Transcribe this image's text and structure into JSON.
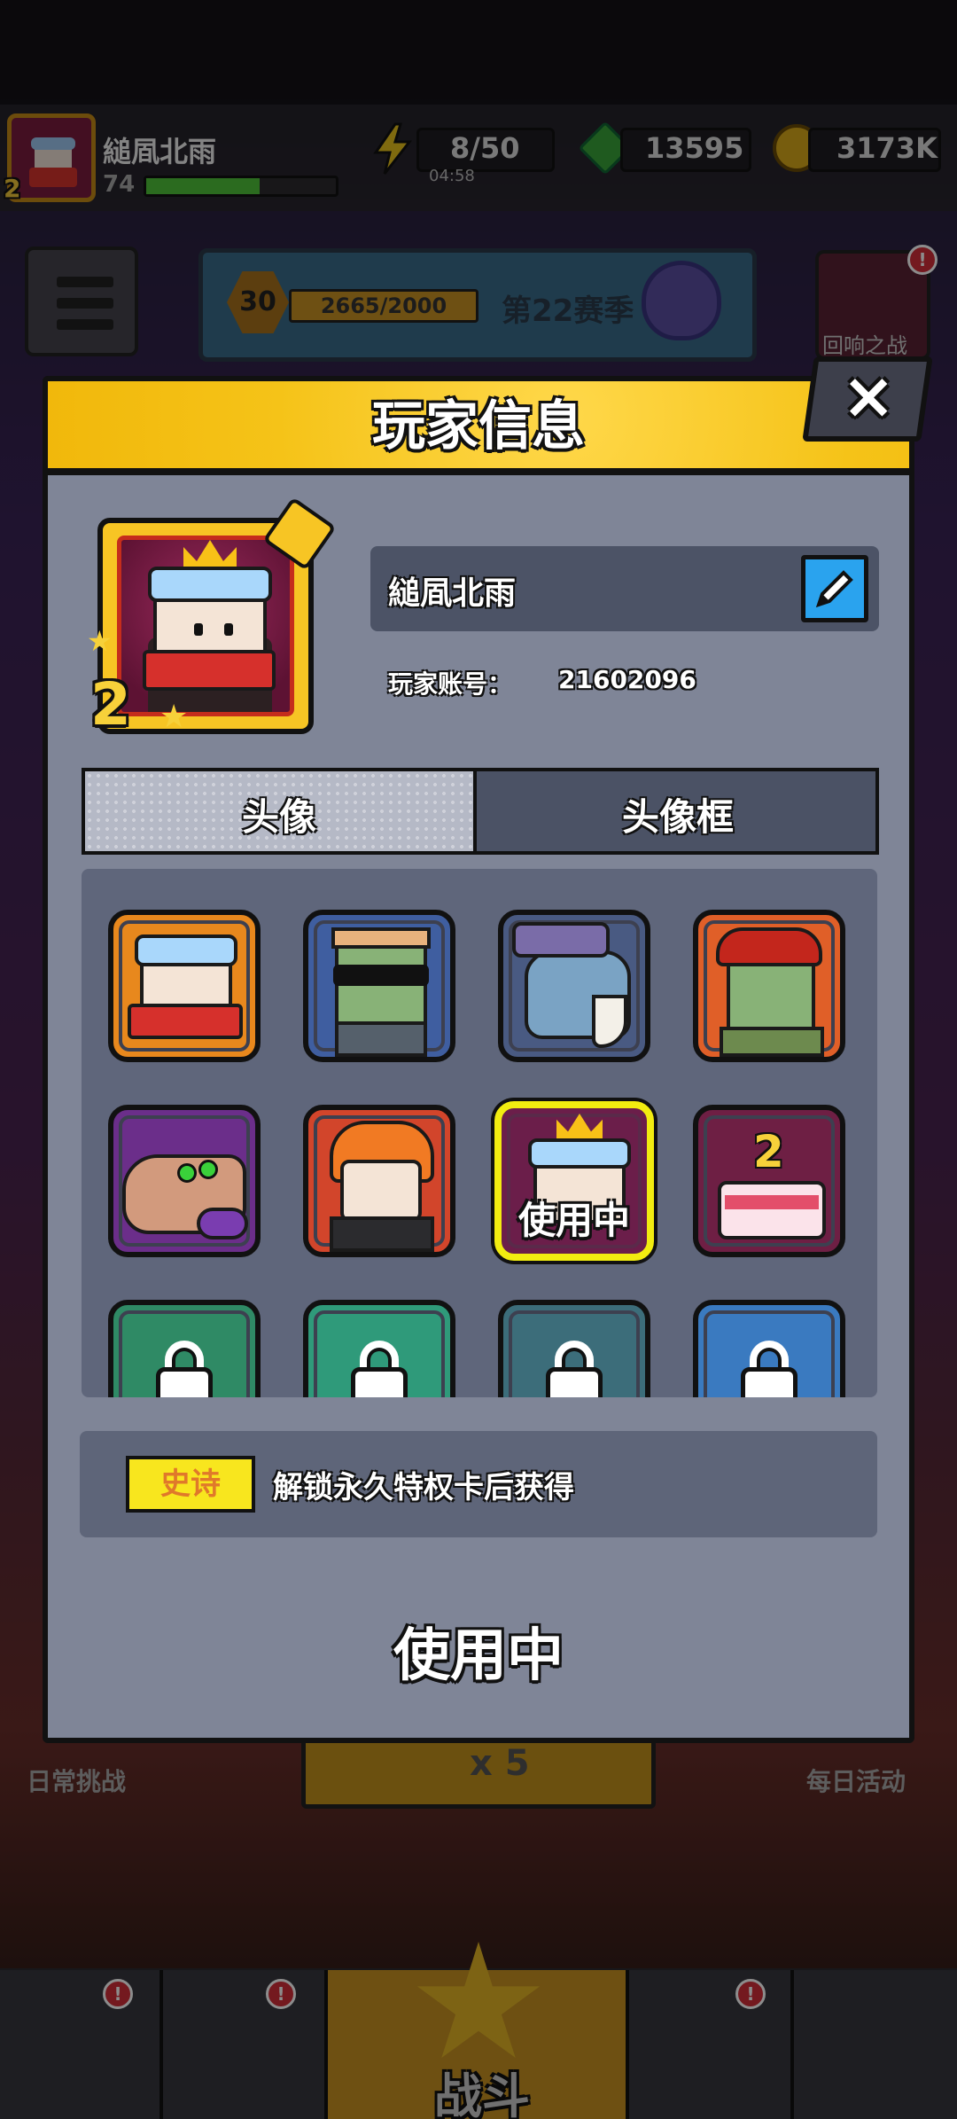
{
  "top_bar": {
    "player_name": "縋凮北雨",
    "level": "74",
    "avatar_level": "2",
    "xp_fraction": 0.6,
    "energy": "8/50",
    "energy_timer": "04:58",
    "gems": "13595",
    "coins": "3173K"
  },
  "season": {
    "level": "30",
    "progress": "2665/2000",
    "name": "第22赛季"
  },
  "echo_battle": {
    "label": "回响之战",
    "badge": "!"
  },
  "background": {
    "daily_challenge": "日常挑战",
    "daily_activity": "每日活动",
    "energy_cost": "x 5",
    "battle_label": "战斗",
    "badge": "!"
  },
  "modal": {
    "title": "玩家信息",
    "close_icon": "×",
    "player_name": "縋凮北雨",
    "player_id_label": "玩家账号：",
    "player_id": "21602096",
    "avatar_level": "2",
    "edit_icon": "pencil-icon",
    "tabs": {
      "avatar": "头像",
      "frame": "头像框"
    },
    "in_use_label": "使用中",
    "rarity": "史诗",
    "unlock_desc": "解锁永久特权卡后获得",
    "use_status": "使用中"
  },
  "colors": {
    "header_yellow": "#f5c318",
    "modal_bg": "#7f8597",
    "selected_border": "#f2ec10",
    "edit_blue": "#2aa3ee",
    "rarity_yellow": "#f8e61e"
  }
}
